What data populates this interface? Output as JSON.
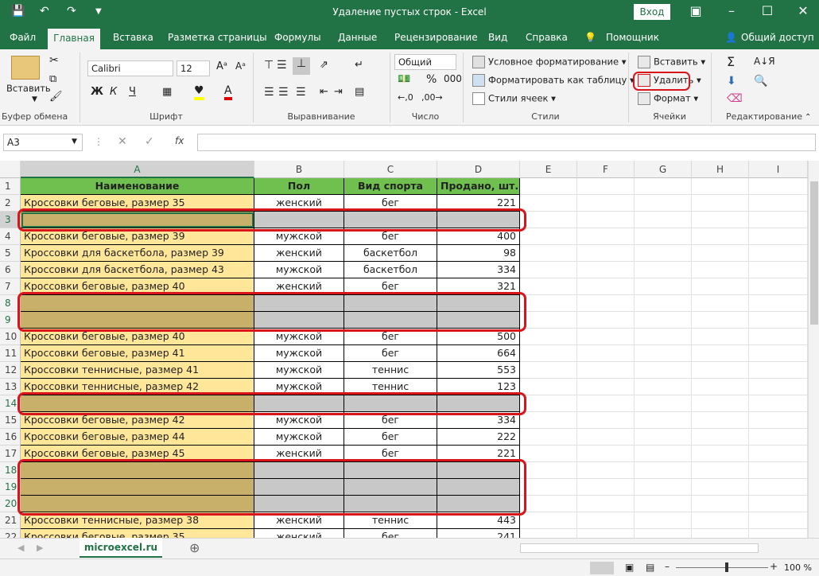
{
  "title": "Удаление пустых строк  -  Excel",
  "login": "Вход",
  "tabs": [
    "Файл",
    "Главная",
    "Вставка",
    "Разметка страницы",
    "Формулы",
    "Данные",
    "Рецензирование",
    "Вид",
    "Справка",
    "Помощник",
    "Общий доступ"
  ],
  "ribbon": {
    "paste": "Вставить",
    "clipboard": "Буфер обмена",
    "font_name": "Calibri",
    "font_size": "12",
    "font": "Шрифт",
    "bold": "Ж",
    "italic": "К",
    "underline": "Ч",
    "alignment": "Выравнивание",
    "number_format": "Общий",
    "number": "Число",
    "cond_format": "Условное форматирование",
    "format_table": "Форматировать как таблицу",
    "cell_styles": "Стили ячеек",
    "styles": "Стили",
    "insert": "Вставить",
    "delete": "Удалить",
    "format": "Формат",
    "cells": "Ячейки",
    "editing": "Редактирование"
  },
  "name_box": "A3",
  "fx": "fx",
  "columns": [
    "A",
    "B",
    "C",
    "D",
    "E",
    "F",
    "G",
    "H",
    "I"
  ],
  "headers": [
    "Наименование",
    "Пол",
    "Вид спорта",
    "Продано, шт."
  ],
  "rows": [
    {
      "n": "1",
      "header": true
    },
    {
      "n": "2",
      "a": "Кроссовки беговые, размер 35",
      "b": "женский",
      "c": "бег",
      "d": "221"
    },
    {
      "n": "3",
      "empty": true
    },
    {
      "n": "4",
      "a": "Кроссовки беговые, размер 39",
      "b": "мужской",
      "c": "бег",
      "d": "400"
    },
    {
      "n": "5",
      "a": "Кроссовки для баскетбола, размер 39",
      "b": "женский",
      "c": "баскетбол",
      "d": "98"
    },
    {
      "n": "6",
      "a": "Кроссовки для баскетбола, размер 43",
      "b": "мужской",
      "c": "баскетбол",
      "d": "334"
    },
    {
      "n": "7",
      "a": "Кроссовки беговые, размер 40",
      "b": "женский",
      "c": "бег",
      "d": "321"
    },
    {
      "n": "8",
      "empty": true
    },
    {
      "n": "9",
      "empty": true
    },
    {
      "n": "10",
      "a": "Кроссовки беговые, размер 40",
      "b": "мужской",
      "c": "бег",
      "d": "500"
    },
    {
      "n": "11",
      "a": "Кроссовки беговые, размер 41",
      "b": "мужской",
      "c": "бег",
      "d": "664"
    },
    {
      "n": "12",
      "a": "Кроссовки теннисные, размер 41",
      "b": "мужской",
      "c": "теннис",
      "d": "553"
    },
    {
      "n": "13",
      "a": "Кроссовки теннисные, размер 42",
      "b": "мужской",
      "c": "теннис",
      "d": "123"
    },
    {
      "n": "14",
      "empty": true
    },
    {
      "n": "15",
      "a": "Кроссовки беговые, размер 42",
      "b": "мужской",
      "c": "бег",
      "d": "334"
    },
    {
      "n": "16",
      "a": "Кроссовки беговые, размер 44",
      "b": "мужской",
      "c": "бег",
      "d": "222"
    },
    {
      "n": "17",
      "a": "Кроссовки беговые, размер 45",
      "b": "женский",
      "c": "бег",
      "d": "221"
    },
    {
      "n": "18",
      "empty": true
    },
    {
      "n": "19",
      "empty": true
    },
    {
      "n": "20",
      "empty": true
    },
    {
      "n": "21",
      "a": "Кроссовки теннисные, размер 38",
      "b": "женский",
      "c": "теннис",
      "d": "443"
    },
    {
      "n": "22",
      "a": "Кроссовки беговые, размер 35",
      "b": "женский",
      "c": "бег",
      "d": "241"
    }
  ],
  "sheet_tab": "microexcel.ru",
  "zoom": "100 %",
  "colors": {
    "green": "#217346",
    "header_green": "#70c050",
    "yellow": "#ffe699",
    "empty_tan": "#c8b06a",
    "gray": "#c8c8c8",
    "red": "#d9141b"
  }
}
